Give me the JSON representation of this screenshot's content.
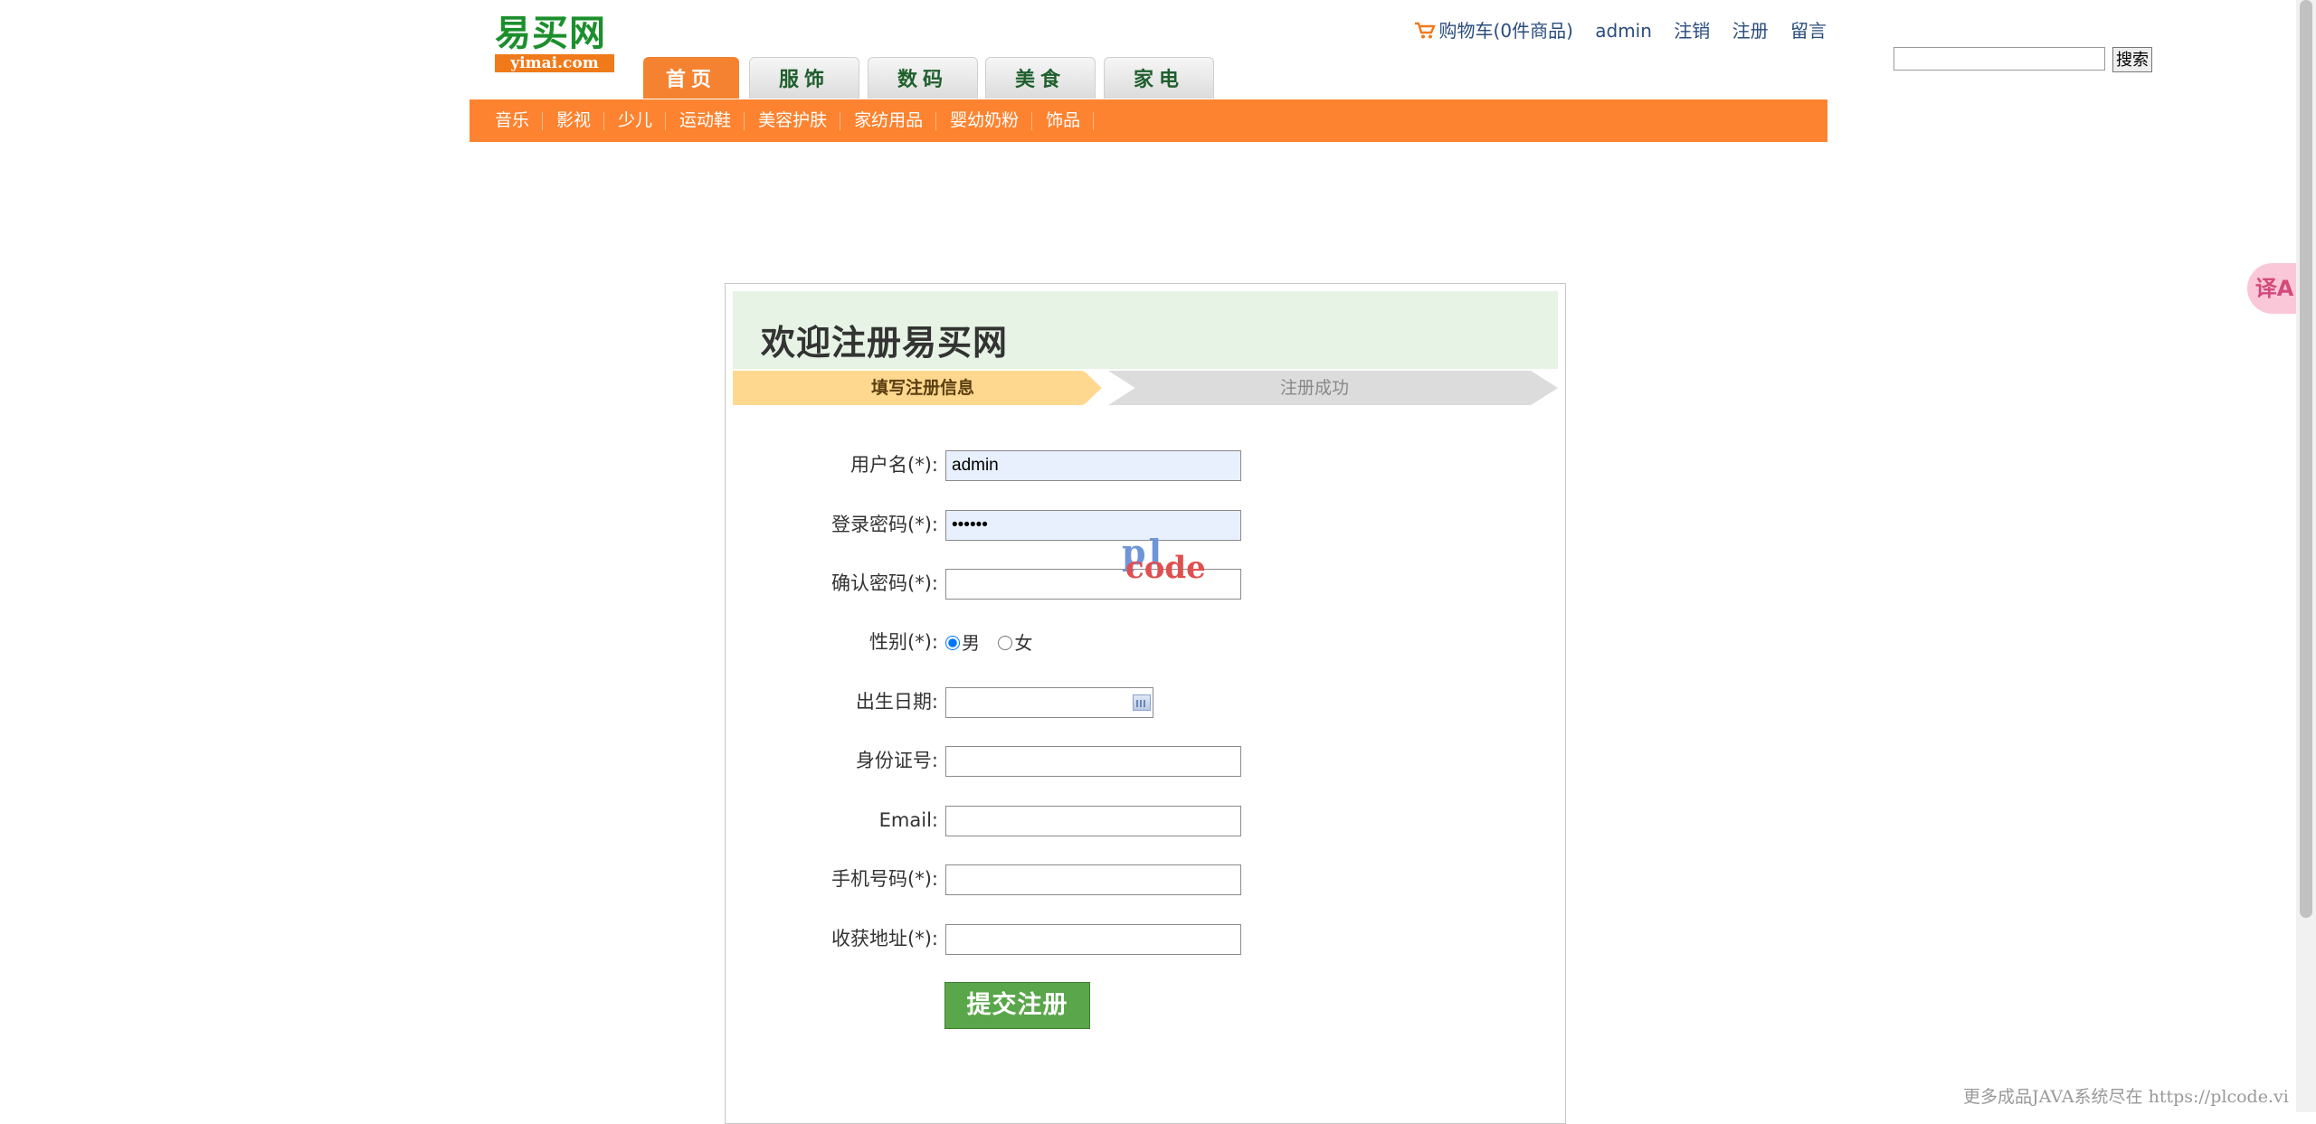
{
  "logo": {
    "cn": "易买网",
    "en": "yimai.com"
  },
  "tabs": [
    {
      "label": "首页",
      "active": true
    },
    {
      "label": "服饰",
      "active": false
    },
    {
      "label": "数码",
      "active": false
    },
    {
      "label": "美食",
      "active": false
    },
    {
      "label": "家电",
      "active": false
    }
  ],
  "toplinks": {
    "cart": "购物车(0件商品)",
    "user": "admin",
    "logout": "注销",
    "register": "注册",
    "message": "留言"
  },
  "search": {
    "value": "",
    "button": "搜索"
  },
  "subnav": [
    "音乐",
    "影视",
    "少儿",
    "运动鞋",
    "美容护肤",
    "家纺用品",
    "婴幼奶粉",
    "饰品"
  ],
  "register": {
    "title": "欢迎注册易买网",
    "step1": "填写注册信息",
    "step2": "注册成功",
    "fields": {
      "username": {
        "label": "用户名(*):",
        "value": "admin"
      },
      "password": {
        "label": "登录密码(*):",
        "value": "123456"
      },
      "confirm": {
        "label": "确认密码(*):",
        "value": ""
      },
      "gender": {
        "label": "性别(*):",
        "male": "男",
        "female": "女",
        "selected": "男"
      },
      "birthday": {
        "label": "出生日期:",
        "value": ""
      },
      "idcard": {
        "label": "身份证号:",
        "value": ""
      },
      "email": {
        "label": "Email:",
        "value": ""
      },
      "mobile": {
        "label": "手机号码(*):",
        "value": ""
      },
      "address": {
        "label": "收获地址(*):",
        "value": ""
      }
    },
    "submit": "提交注册"
  },
  "watermark": {
    "line1": "pl",
    "line2": "code"
  },
  "translate_button": "译A",
  "footer_note": "更多成品JAVA系统尽在 https://plcode.vi",
  "colors": {
    "orange": "#fd8330",
    "green": "#5aa64a",
    "welcome_bg": "#e6f3e5"
  }
}
